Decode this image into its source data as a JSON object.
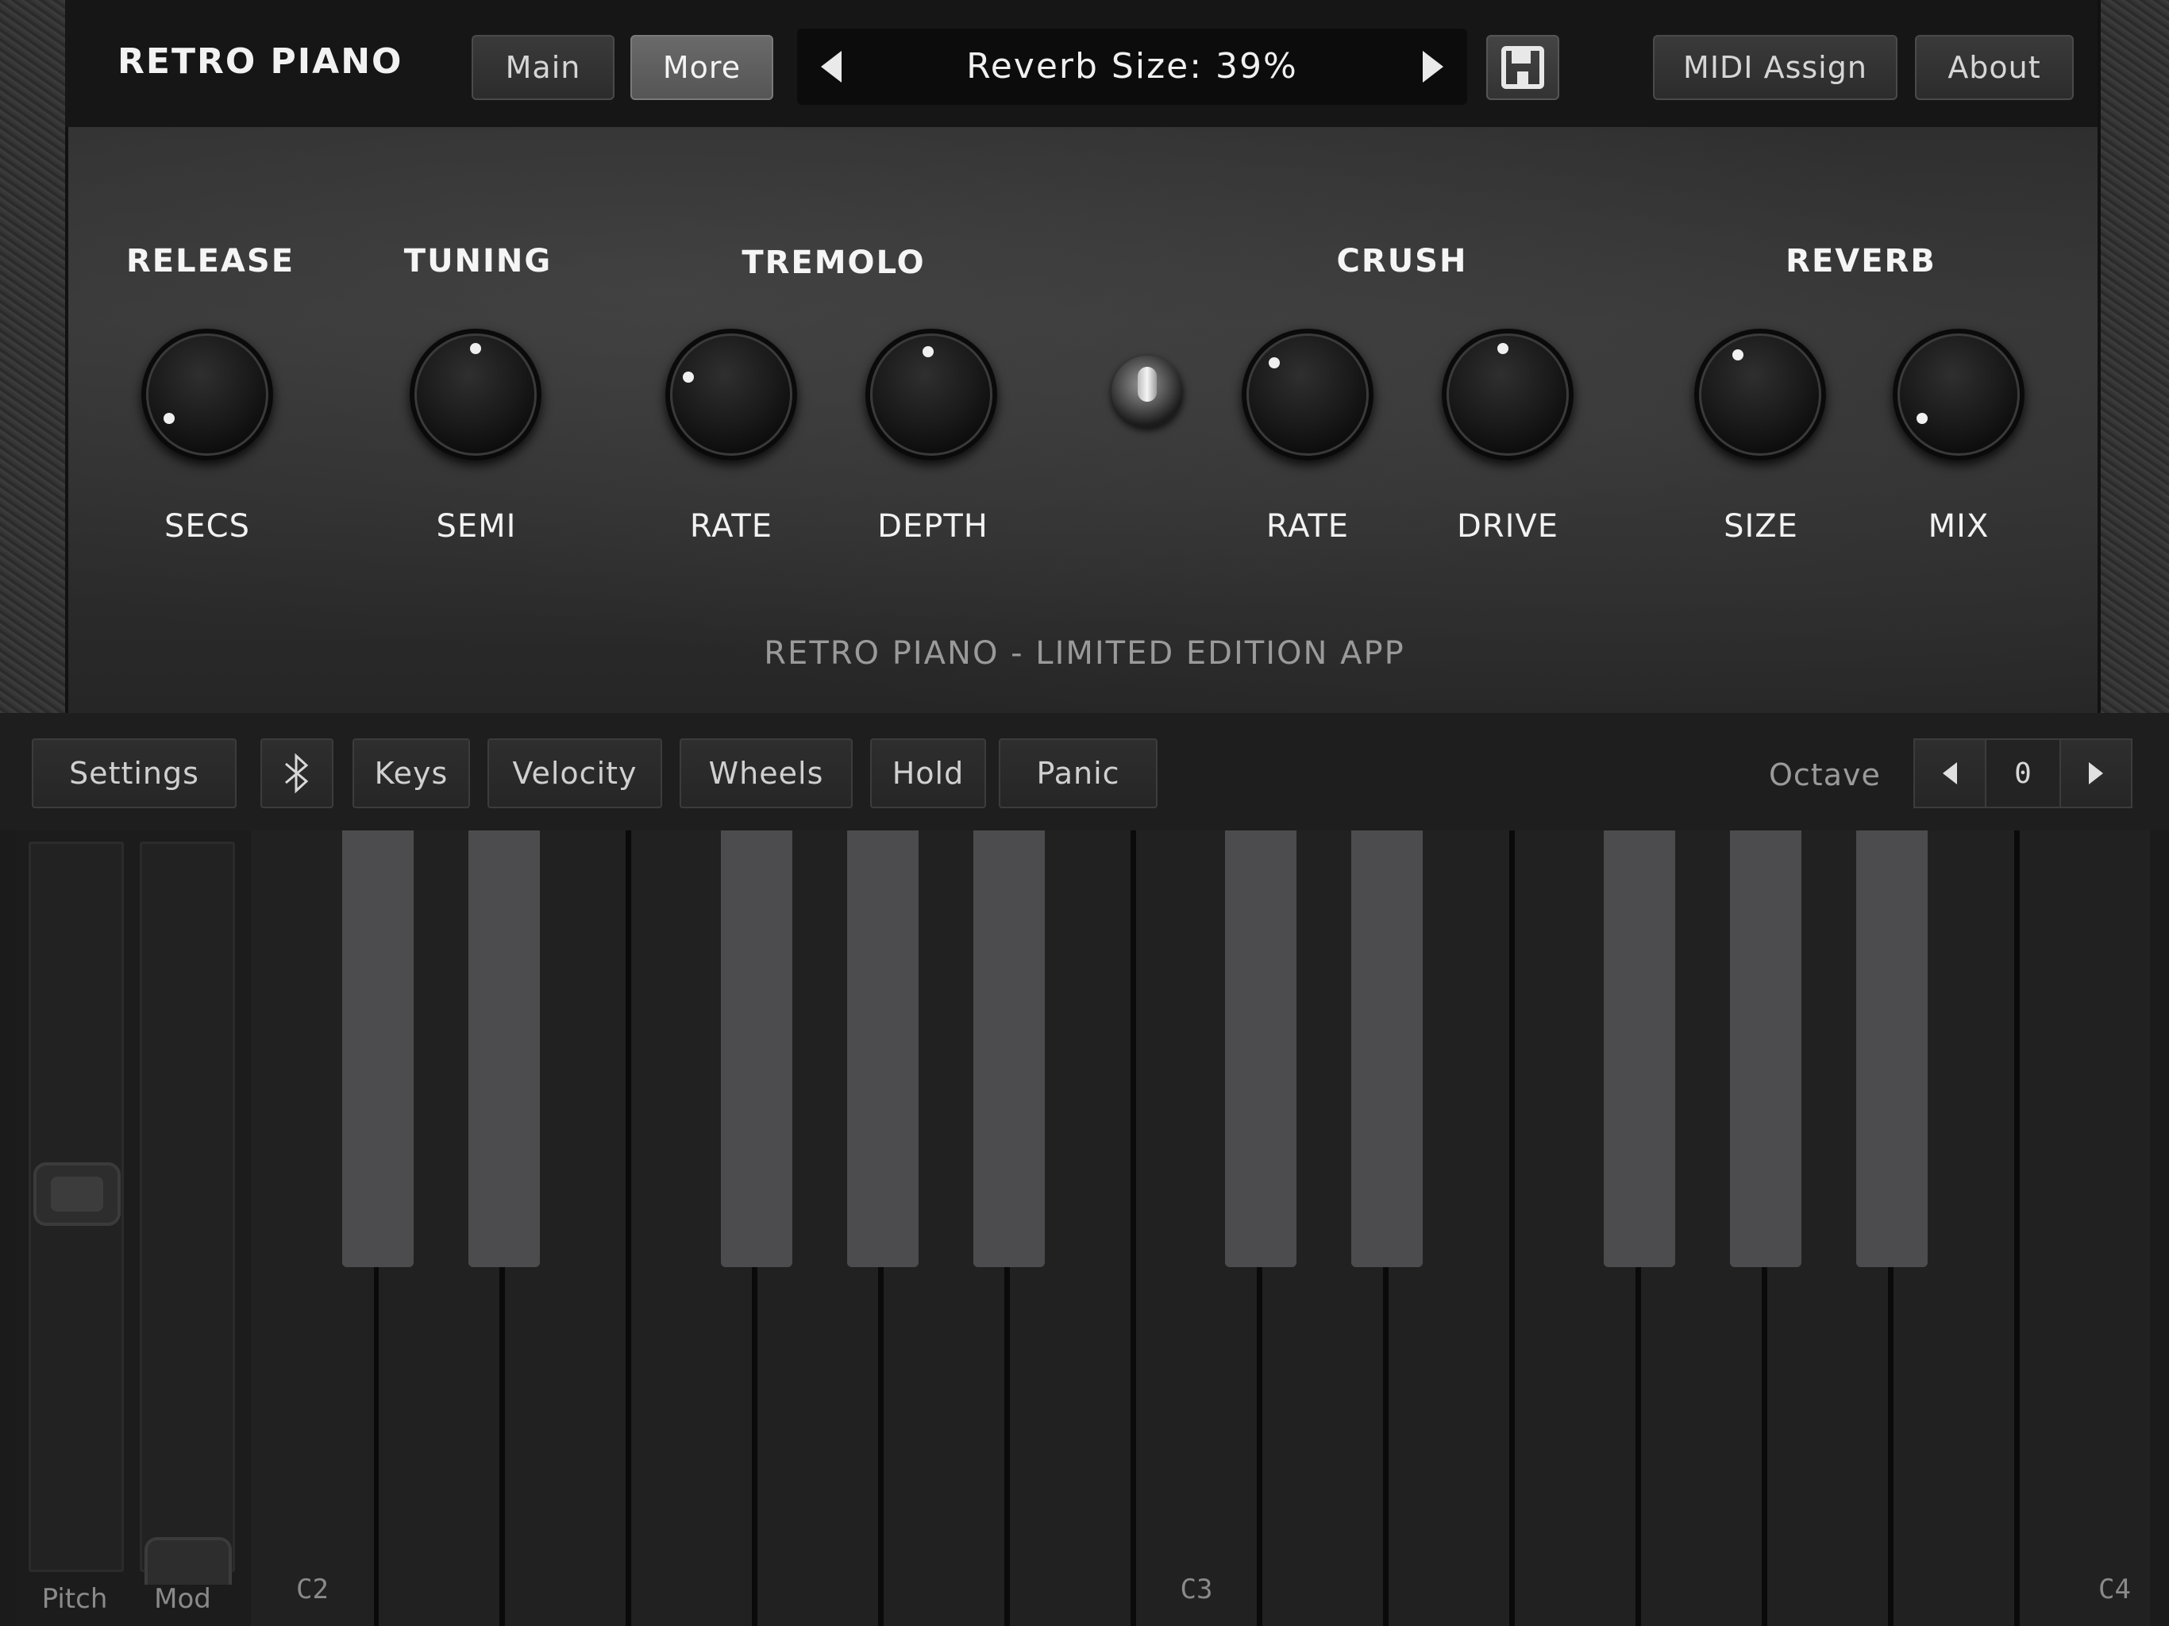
{
  "app": {
    "title": "RETRO PIANO"
  },
  "nav": {
    "main": "Main",
    "more": "More",
    "midi_assign": "MIDI Assign",
    "about": "About"
  },
  "preset": {
    "display": "Reverb Size: 39%"
  },
  "sections": {
    "release": {
      "title": "RELEASE",
      "knobs": [
        {
          "label": "SECS"
        }
      ]
    },
    "tuning": {
      "title": "TUNING",
      "knobs": [
        {
          "label": "SEMI"
        }
      ]
    },
    "tremolo": {
      "title": "TREMOLO",
      "knobs": [
        {
          "label": "RATE"
        },
        {
          "label": "DEPTH"
        }
      ]
    },
    "crush": {
      "title": "CRUSH",
      "knobs": [
        {
          "label": "RATE"
        },
        {
          "label": "DRIVE"
        }
      ]
    },
    "reverb": {
      "title": "REVERB",
      "knobs": [
        {
          "label": "SIZE"
        },
        {
          "label": "MIX"
        }
      ]
    }
  },
  "footer": {
    "text": "RETRO PIANO - LIMITED EDITION APP"
  },
  "controls": {
    "settings": "Settings",
    "bluetooth_icon": "bluetooth-icon",
    "keys": "Keys",
    "velocity": "Velocity",
    "wheels": "Wheels",
    "hold": "Hold",
    "panic": "Panic",
    "octave_label": "Octave",
    "octave_value": "0"
  },
  "wheels": {
    "pitch": "Pitch",
    "mod": "Mod"
  },
  "keyboard": {
    "notes": {
      "c2": "C2",
      "c3": "C3",
      "c4": "C4"
    }
  }
}
